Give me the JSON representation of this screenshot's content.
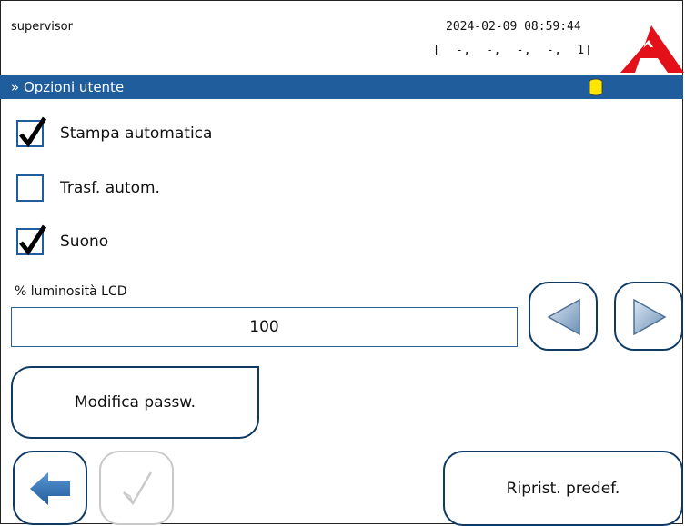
{
  "header": {
    "user": "supervisor",
    "datetime": "2024-02-09 08:59:44",
    "counters": "[  -,  -,  -,  -,  1]"
  },
  "titlebar": {
    "title": "» Opzioni utente",
    "status_icon": "database-icon",
    "status_color": "#ffe600",
    "bar_color": "#1f5d9c"
  },
  "options": [
    {
      "label": "Stampa automatica",
      "checked": true
    },
    {
      "label": "Trasf. autom.",
      "checked": false
    },
    {
      "label": "Suono",
      "checked": true
    }
  ],
  "brightness": {
    "label": "% luminosità LCD",
    "value": "100"
  },
  "buttons": {
    "change_password": "Modifica passw.",
    "reset_defaults": "Riprist. predef."
  },
  "colors": {
    "accent": "#1f5d9c",
    "logo_red": "#e3101a",
    "button_border": "#0f3a63"
  }
}
